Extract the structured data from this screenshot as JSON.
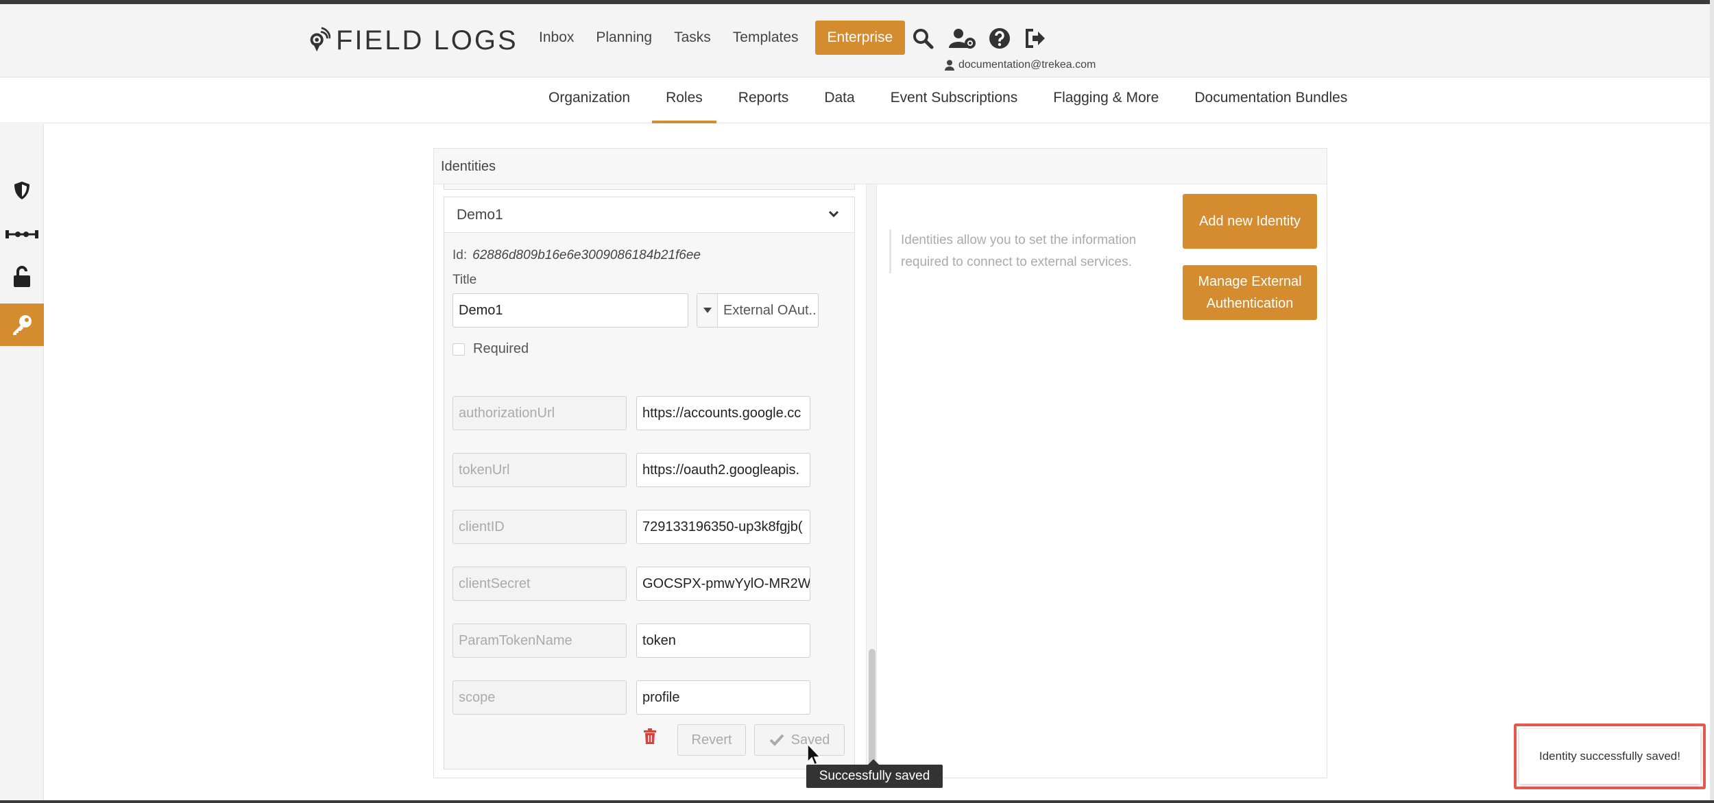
{
  "header": {
    "logo_text": "FIELD LOGS",
    "nav": [
      "Inbox",
      "Planning",
      "Tasks",
      "Templates",
      "Enterprise"
    ],
    "user_email": "documentation@trekea.com",
    "icons": [
      "search-icon",
      "user-settings-icon",
      "help-icon",
      "logout-icon"
    ]
  },
  "subnav": {
    "items": [
      "Organization",
      "Roles",
      "Reports",
      "Data",
      "Event Subscriptions",
      "Flagging & More",
      "Documentation Bundles"
    ],
    "active": "Roles"
  },
  "sidebar": {
    "icons": [
      "shield-icon",
      "connector-icon",
      "unlock-icon",
      "key-icon"
    ],
    "active": "key-icon"
  },
  "panel": {
    "title": "Identities",
    "identity": {
      "name": "Demo1",
      "id_label": "Id:",
      "id_value": "62886d809b16e6e3009086184b21f6ee",
      "title_label": "Title",
      "title_value": "Demo1",
      "type_value": "External OAut..",
      "required_label": "Required",
      "fields": [
        {
          "key": "authorizationUrl",
          "value": "https://accounts.google.cc"
        },
        {
          "key": "tokenUrl",
          "value": "https://oauth2.googleapis."
        },
        {
          "key": "clientID",
          "value": "729133196350-up3k8fgjb("
        },
        {
          "key": "clientSecret",
          "value": "GOCSPX-pmwYylO-MR2W"
        },
        {
          "key": "ParamTokenName",
          "value": "token"
        },
        {
          "key": "scope",
          "value": "profile"
        }
      ],
      "revert_label": "Revert",
      "saved_label": "Saved"
    },
    "info_text": "Identities allow you to set the information required to connect to external services.",
    "add_button": "Add new Identity",
    "manage_button": "Manage External Authentication"
  },
  "tooltip": "Successfully saved",
  "toast": "Identity successfully saved!",
  "colors": {
    "accent": "#d48c2e",
    "toast_outline": "#e45a4e"
  }
}
